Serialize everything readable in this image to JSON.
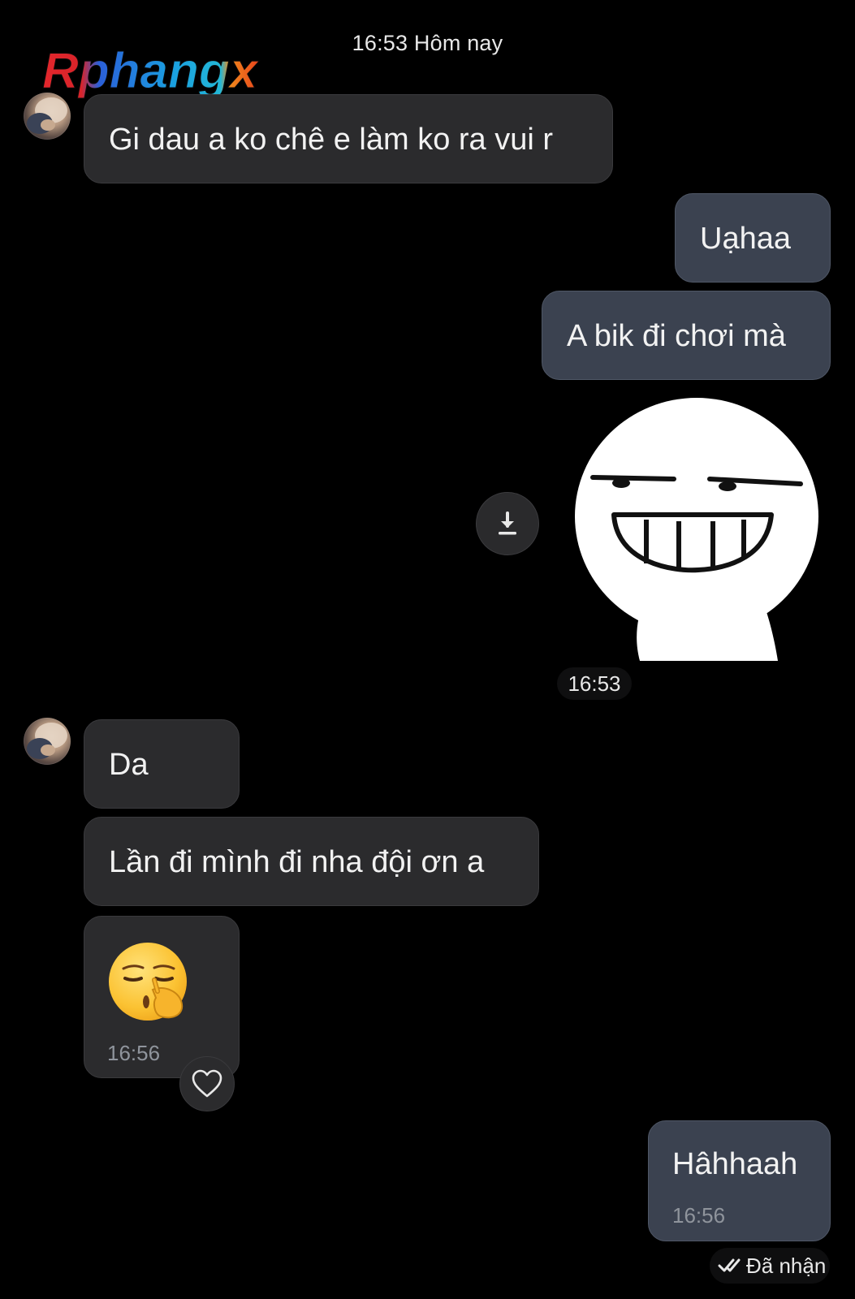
{
  "header": {
    "date_time": "16:53 Hôm nay"
  },
  "watermark": {
    "text": "Rphangx"
  },
  "messages": [
    {
      "direction": "in",
      "text": "Gi dau a ko chê e làm ko ra vui r"
    },
    {
      "direction": "out",
      "text": "Uạhaa"
    },
    {
      "direction": "out",
      "text": "A bik đi chơi mà"
    },
    {
      "direction": "out",
      "type": "sticker",
      "sticker": "grinning-face-sticker",
      "time": "16:53"
    },
    {
      "direction": "in",
      "text": "Da"
    },
    {
      "direction": "in",
      "text": "Lần đi mình đi nha đội ơn a"
    },
    {
      "direction": "in",
      "type": "emoji",
      "emoji": "shushing-face-emoji",
      "time": "16:56"
    },
    {
      "direction": "out",
      "text": "Hâhhaah",
      "time": "16:56"
    }
  ],
  "status": {
    "label": "Đã nhận"
  },
  "colors": {
    "background": "#000000",
    "incoming_bubble": "#2b2b2d",
    "outgoing_bubble": "#3b4250",
    "timestamp": "#8f949c"
  }
}
